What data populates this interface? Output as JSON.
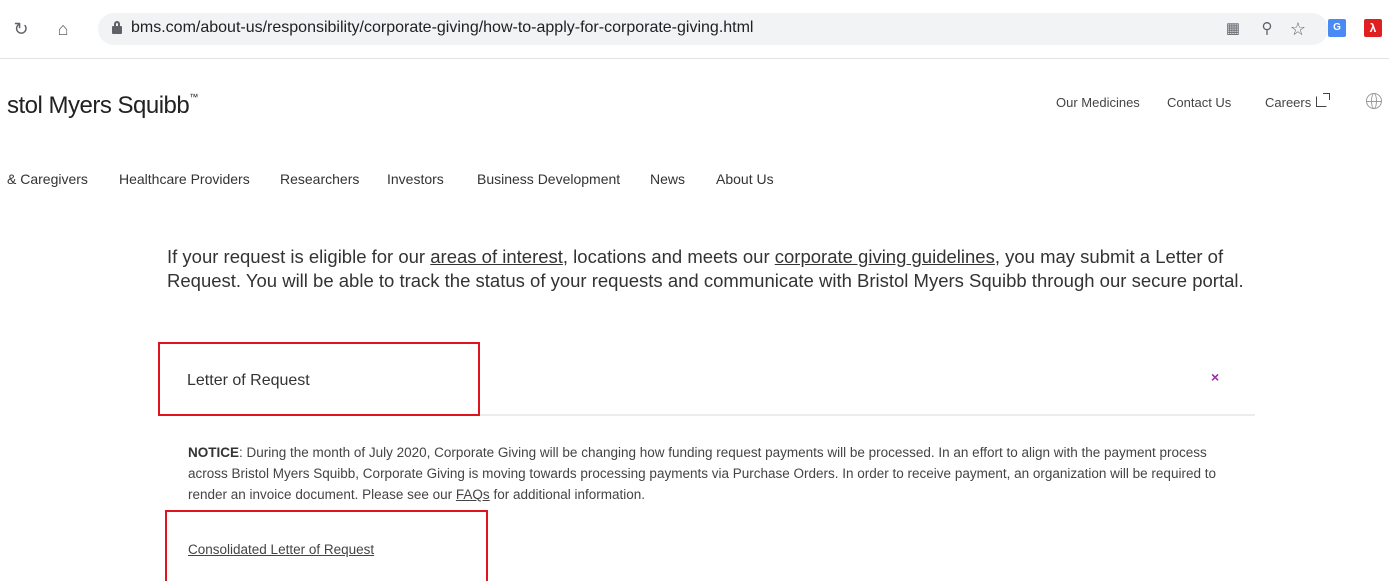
{
  "browser": {
    "url": "bms.com/about-us/responsibility/corporate-giving/how-to-apply-for-corporate-giving.html",
    "icons": [
      "reload-icon",
      "home-icon",
      "lock-icon",
      "qr-code-icon",
      "zoom-icon",
      "star-icon",
      "translate-extension-icon",
      "pdf-extension-icon"
    ]
  },
  "header": {
    "logo_text": "stol Myers Squibb",
    "logo_mark": "™",
    "utility_links": [
      "Our Medicines",
      "Contact Us",
      "Careers"
    ]
  },
  "main_nav": [
    "& Caregivers",
    "Healthcare Providers",
    "Researchers",
    "Investors",
    "Business Development",
    "News",
    "About Us"
  ],
  "intro": {
    "part1": "If your request is eligible for our ",
    "link1": "areas of interest",
    "part2": ", locations and meets our ",
    "link2": "corporate giving guidelines",
    "part3": ", you may submit a Letter of Request. You will be able to track the status of your requests and communicate with Bristol Myers Squibb through our secure portal."
  },
  "accordion": {
    "title": "Letter of Request",
    "close_glyph": "×"
  },
  "notice": {
    "label": "NOTICE",
    "text": ": During the month of July 2020, Corporate Giving will be changing how funding request payments will be processed. In an effort to align with the payment process across Bristol Myers Squibb, Corporate Giving is moving towards processing payments via Purchase Orders. In order to receive payment, an organization will be required to render an invoice document. Please see our ",
    "link": "FAQs",
    "text_end": " for additional information."
  },
  "consolidated_link": "Consolidated Letter of Request",
  "colors": {
    "highlight": "#e0141e",
    "accent_close": "#9b2d9e"
  }
}
